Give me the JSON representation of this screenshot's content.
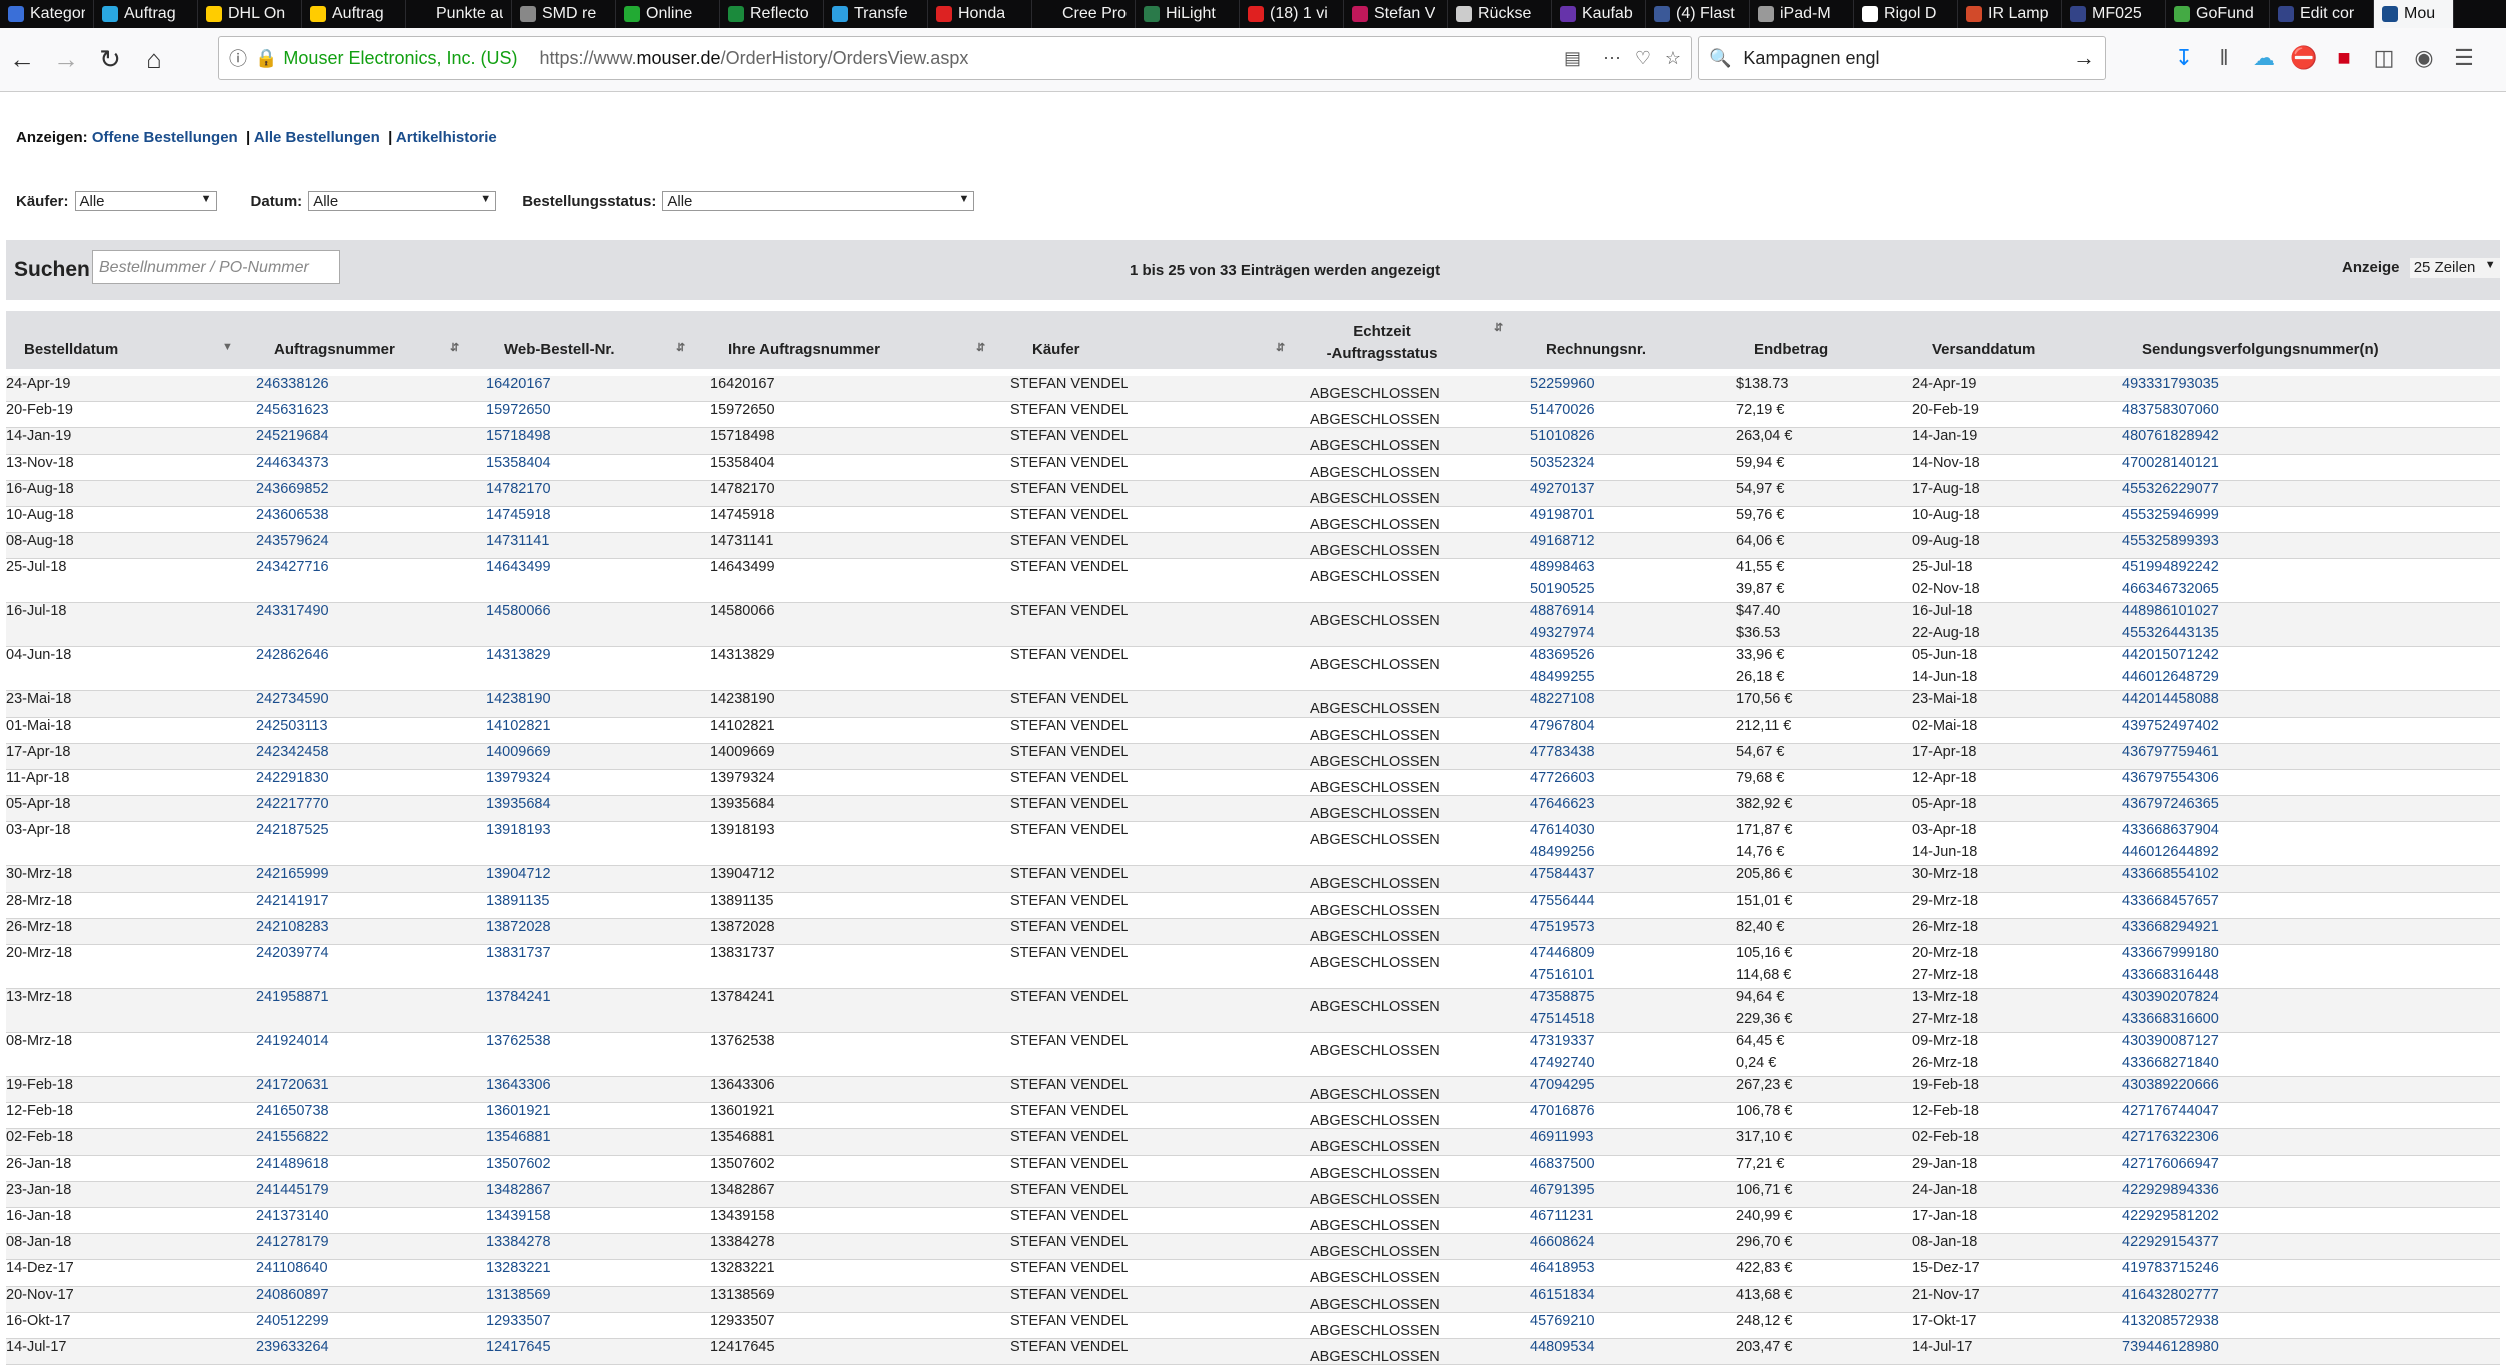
{
  "browser": {
    "tabs": [
      {
        "label": "Kategor",
        "color": "#3a6fd8"
      },
      {
        "label": "Auftrag",
        "color": "#2aa7e0"
      },
      {
        "label": "DHL On",
        "color": "#ffcc00"
      },
      {
        "label": "Auftrag",
        "color": "#ffcc00"
      },
      {
        "label": "Punkte auf e",
        "color": "#0c0c0d"
      },
      {
        "label": "SMD re",
        "color": "#888888"
      },
      {
        "label": "Online",
        "color": "#22aa33"
      },
      {
        "label": "Reflecto",
        "color": "#1b8a3c"
      },
      {
        "label": "Transfe",
        "color": "#2d9fe0"
      },
      {
        "label": "Honda",
        "color": "#dd2222"
      },
      {
        "label": "Cree Produc",
        "color": "#0c0c0d"
      },
      {
        "label": "HiLight",
        "color": "#2a7a4a"
      },
      {
        "label": "(18) 1 vi",
        "color": "#e02020"
      },
      {
        "label": "Stefan V",
        "color": "#c0185a"
      },
      {
        "label": "Rückse",
        "color": "#cccccc"
      },
      {
        "label": "Kaufab",
        "color": "#6633aa"
      },
      {
        "label": "(4) Flast",
        "color": "#3b5998"
      },
      {
        "label": "iPad-M",
        "color": "#999999"
      },
      {
        "label": "Rigol D",
        "color": "#ffffff"
      },
      {
        "label": "IR Lamp",
        "color": "#d24a2a"
      },
      {
        "label": "MF025",
        "color": "#334488"
      },
      {
        "label": "GoFund",
        "color": "#44aa44"
      },
      {
        "label": "Edit cor",
        "color": "#334488"
      },
      {
        "label": "Mou",
        "color": "#1a4d8c"
      }
    ],
    "site_identity": "Mouser Electronics, Inc. (US)",
    "url_prefix": "https://www.",
    "url_domain": "mouser.de",
    "url_path": "/OrderHistory/OrdersView.aspx",
    "search_text": "Kampagnen engl"
  },
  "view": {
    "label": "Anzeigen:",
    "open_orders": "Offene Bestellungen",
    "all_orders": "Alle Bestellungen",
    "item_history": "Artikelhistorie",
    "sep": "|"
  },
  "filters": {
    "buyer_label": "Käufer:",
    "buyer_value": "Alle",
    "date_label": "Datum:",
    "date_value": "Alle",
    "status_label": "Bestellungsstatus:",
    "status_value": "Alle"
  },
  "search": {
    "label": "Suchen",
    "placeholder": "Bestellnummer / PO-Nummer",
    "count_text": "1 bis 25 von 33 Einträgen werden angezeigt",
    "show_label": "Anzeige",
    "show_value": "25 Zeilen"
  },
  "table": {
    "headers": {
      "date": "Bestelldatum",
      "order": "Auftragsnummer",
      "web": "Web-Bestell-Nr.",
      "your": "Ihre Auftragsnummer",
      "buyer": "Käufer",
      "status1": "Echtzeit",
      "status2": "-Auftragsstatus",
      "invoice": "Rechnungsnr.",
      "total": "Endbetrag",
      "ship": "Versanddatum",
      "tracking": "Sendungsverfolgungsnummer(n)"
    },
    "rows": [
      {
        "date": "24-Apr-19",
        "order": "246338126",
        "web": "16420167",
        "your": "16420167",
        "buyer": "STEFAN VENDEL",
        "status": "ABGESCHLOSSEN",
        "invoice": [
          "52259960"
        ],
        "total": [
          "$138.73"
        ],
        "ship": [
          "24-Apr-19"
        ],
        "tracking": [
          "493331793035"
        ]
      },
      {
        "date": "20-Feb-19",
        "order": "245631623",
        "web": "15972650",
        "your": "15972650",
        "buyer": "STEFAN VENDEL",
        "status": "ABGESCHLOSSEN",
        "invoice": [
          "51470026"
        ],
        "total": [
          "72,19 €"
        ],
        "ship": [
          "20-Feb-19"
        ],
        "tracking": [
          "483758307060"
        ]
      },
      {
        "date": "14-Jan-19",
        "order": "245219684",
        "web": "15718498",
        "your": "15718498",
        "buyer": "STEFAN VENDEL",
        "status": "ABGESCHLOSSEN",
        "invoice": [
          "51010826"
        ],
        "total": [
          "263,04 €"
        ],
        "ship": [
          "14-Jan-19"
        ],
        "tracking": [
          "480761828942"
        ]
      },
      {
        "date": "13-Nov-18",
        "order": "244634373",
        "web": "15358404",
        "your": "15358404",
        "buyer": "STEFAN VENDEL",
        "status": "ABGESCHLOSSEN",
        "invoice": [
          "50352324"
        ],
        "total": [
          "59,94 €"
        ],
        "ship": [
          "14-Nov-18"
        ],
        "tracking": [
          "470028140121"
        ]
      },
      {
        "date": "16-Aug-18",
        "order": "243669852",
        "web": "14782170",
        "your": "14782170",
        "buyer": "STEFAN VENDEL",
        "status": "ABGESCHLOSSEN",
        "invoice": [
          "49270137"
        ],
        "total": [
          "54,97 €"
        ],
        "ship": [
          "17-Aug-18"
        ],
        "tracking": [
          "455326229077"
        ]
      },
      {
        "date": "10-Aug-18",
        "order": "243606538",
        "web": "14745918",
        "your": "14745918",
        "buyer": "STEFAN VENDEL",
        "status": "ABGESCHLOSSEN",
        "invoice": [
          "49198701"
        ],
        "total": [
          "59,76 €"
        ],
        "ship": [
          "10-Aug-18"
        ],
        "tracking": [
          "455325946999"
        ]
      },
      {
        "date": "08-Aug-18",
        "order": "243579624",
        "web": "14731141",
        "your": "14731141",
        "buyer": "STEFAN VENDEL",
        "status": "ABGESCHLOSSEN",
        "invoice": [
          "49168712"
        ],
        "total": [
          "64,06 €"
        ],
        "ship": [
          "09-Aug-18"
        ],
        "tracking": [
          "455325899393"
        ]
      },
      {
        "date": "25-Jul-18",
        "order": "243427716",
        "web": "14643499",
        "your": "14643499",
        "buyer": "STEFAN VENDEL",
        "status": "ABGESCHLOSSEN",
        "invoice": [
          "48998463",
          "50190525"
        ],
        "total": [
          "41,55 €",
          "39,87 €"
        ],
        "ship": [
          "25-Jul-18",
          "02-Nov-18"
        ],
        "tracking": [
          "451994892242",
          "466346732065"
        ]
      },
      {
        "date": "16-Jul-18",
        "order": "243317490",
        "web": "14580066",
        "your": "14580066",
        "buyer": "STEFAN VENDEL",
        "status": "ABGESCHLOSSEN",
        "invoice": [
          "48876914",
          "49327974"
        ],
        "total": [
          "$47.40",
          "$36.53"
        ],
        "ship": [
          "16-Jul-18",
          "22-Aug-18"
        ],
        "tracking": [
          "448986101027",
          "455326443135"
        ]
      },
      {
        "date": "04-Jun-18",
        "order": "242862646",
        "web": "14313829",
        "your": "14313829",
        "buyer": "STEFAN VENDEL",
        "status": "ABGESCHLOSSEN",
        "invoice": [
          "48369526",
          "48499255"
        ],
        "total": [
          "33,96 €",
          "26,18 €"
        ],
        "ship": [
          "05-Jun-18",
          "14-Jun-18"
        ],
        "tracking": [
          "442015071242",
          "446012648729"
        ]
      },
      {
        "date": "23-Mai-18",
        "order": "242734590",
        "web": "14238190",
        "your": "14238190",
        "buyer": "STEFAN VENDEL",
        "status": "ABGESCHLOSSEN",
        "invoice": [
          "48227108"
        ],
        "total": [
          "170,56 €"
        ],
        "ship": [
          "23-Mai-18"
        ],
        "tracking": [
          "442014458088"
        ]
      },
      {
        "date": "01-Mai-18",
        "order": "242503113",
        "web": "14102821",
        "your": "14102821",
        "buyer": "STEFAN VENDEL",
        "status": "ABGESCHLOSSEN",
        "invoice": [
          "47967804"
        ],
        "total": [
          "212,11 €"
        ],
        "ship": [
          "02-Mai-18"
        ],
        "tracking": [
          "439752497402"
        ]
      },
      {
        "date": "17-Apr-18",
        "order": "242342458",
        "web": "14009669",
        "your": "14009669",
        "buyer": "STEFAN VENDEL",
        "status": "ABGESCHLOSSEN",
        "invoice": [
          "47783438"
        ],
        "total": [
          "54,67 €"
        ],
        "ship": [
          "17-Apr-18"
        ],
        "tracking": [
          "436797759461"
        ]
      },
      {
        "date": "11-Apr-18",
        "order": "242291830",
        "web": "13979324",
        "your": "13979324",
        "buyer": "STEFAN VENDEL",
        "status": "ABGESCHLOSSEN",
        "invoice": [
          "47726603"
        ],
        "total": [
          "79,68 €"
        ],
        "ship": [
          "12-Apr-18"
        ],
        "tracking": [
          "436797554306"
        ]
      },
      {
        "date": "05-Apr-18",
        "order": "242217770",
        "web": "13935684",
        "your": "13935684",
        "buyer": "STEFAN VENDEL",
        "status": "ABGESCHLOSSEN",
        "invoice": [
          "47646623"
        ],
        "total": [
          "382,92 €"
        ],
        "ship": [
          "05-Apr-18"
        ],
        "tracking": [
          "436797246365"
        ]
      },
      {
        "date": "03-Apr-18",
        "order": "242187525",
        "web": "13918193",
        "your": "13918193",
        "buyer": "STEFAN VENDEL",
        "status": "ABGESCHLOSSEN",
        "invoice": [
          "47614030",
          "48499256"
        ],
        "total": [
          "171,87 €",
          "14,76 €"
        ],
        "ship": [
          "03-Apr-18",
          "14-Jun-18"
        ],
        "tracking": [
          "433668637904",
          "446012644892"
        ]
      },
      {
        "date": "30-Mrz-18",
        "order": "242165999",
        "web": "13904712",
        "your": "13904712",
        "buyer": "STEFAN VENDEL",
        "status": "ABGESCHLOSSEN",
        "invoice": [
          "47584437"
        ],
        "total": [
          "205,86 €"
        ],
        "ship": [
          "30-Mrz-18"
        ],
        "tracking": [
          "433668554102"
        ]
      },
      {
        "date": "28-Mrz-18",
        "order": "242141917",
        "web": "13891135",
        "your": "13891135",
        "buyer": "STEFAN VENDEL",
        "status": "ABGESCHLOSSEN",
        "invoice": [
          "47556444"
        ],
        "total": [
          "151,01 €"
        ],
        "ship": [
          "29-Mrz-18"
        ],
        "tracking": [
          "433668457657"
        ]
      },
      {
        "date": "26-Mrz-18",
        "order": "242108283",
        "web": "13872028",
        "your": "13872028",
        "buyer": "STEFAN VENDEL",
        "status": "ABGESCHLOSSEN",
        "invoice": [
          "47519573"
        ],
        "total": [
          "82,40 €"
        ],
        "ship": [
          "26-Mrz-18"
        ],
        "tracking": [
          "433668294921"
        ]
      },
      {
        "date": "20-Mrz-18",
        "order": "242039774",
        "web": "13831737",
        "your": "13831737",
        "buyer": "STEFAN VENDEL",
        "status": "ABGESCHLOSSEN",
        "invoice": [
          "47446809",
          "47516101"
        ],
        "total": [
          "105,16 €",
          "114,68 €"
        ],
        "ship": [
          "20-Mrz-18",
          "27-Mrz-18"
        ],
        "tracking": [
          "433667999180",
          "433668316448"
        ]
      },
      {
        "date": "13-Mrz-18",
        "order": "241958871",
        "web": "13784241",
        "your": "13784241",
        "buyer": "STEFAN VENDEL",
        "status": "ABGESCHLOSSEN",
        "invoice": [
          "47358875",
          "47514518"
        ],
        "total": [
          "94,64 €",
          "229,36 €"
        ],
        "ship": [
          "13-Mrz-18",
          "27-Mrz-18"
        ],
        "tracking": [
          "430390207824",
          "433668316600"
        ]
      },
      {
        "date": "08-Mrz-18",
        "order": "241924014",
        "web": "13762538",
        "your": "13762538",
        "buyer": "STEFAN VENDEL",
        "status": "ABGESCHLOSSEN",
        "invoice": [
          "47319337",
          "47492740"
        ],
        "total": [
          "64,45 €",
          "0,24 €"
        ],
        "ship": [
          "09-Mrz-18",
          "26-Mrz-18"
        ],
        "tracking": [
          "430390087127",
          "433668271840"
        ]
      },
      {
        "date": "19-Feb-18",
        "order": "241720631",
        "web": "13643306",
        "your": "13643306",
        "buyer": "STEFAN VENDEL",
        "status": "ABGESCHLOSSEN",
        "invoice": [
          "47094295"
        ],
        "total": [
          "267,23 €"
        ],
        "ship": [
          "19-Feb-18"
        ],
        "tracking": [
          "430389220666"
        ]
      },
      {
        "date": "12-Feb-18",
        "order": "241650738",
        "web": "13601921",
        "your": "13601921",
        "buyer": "STEFAN VENDEL",
        "status": "ABGESCHLOSSEN",
        "invoice": [
          "47016876"
        ],
        "total": [
          "106,78 €"
        ],
        "ship": [
          "12-Feb-18"
        ],
        "tracking": [
          "427176744047"
        ]
      },
      {
        "date": "02-Feb-18",
        "order": "241556822",
        "web": "13546881",
        "your": "13546881",
        "buyer": "STEFAN VENDEL",
        "status": "ABGESCHLOSSEN",
        "invoice": [
          "46911993"
        ],
        "total": [
          "317,10 €"
        ],
        "ship": [
          "02-Feb-18"
        ],
        "tracking": [
          "427176322306"
        ]
      },
      {
        "date": "26-Jan-18",
        "order": "241489618",
        "web": "13507602",
        "your": "13507602",
        "buyer": "STEFAN VENDEL",
        "status": "ABGESCHLOSSEN",
        "invoice": [
          "46837500"
        ],
        "total": [
          "77,21 €"
        ],
        "ship": [
          "29-Jan-18"
        ],
        "tracking": [
          "427176066947"
        ]
      },
      {
        "date": "23-Jan-18",
        "order": "241445179",
        "web": "13482867",
        "your": "13482867",
        "buyer": "STEFAN VENDEL",
        "status": "ABGESCHLOSSEN",
        "invoice": [
          "46791395"
        ],
        "total": [
          "106,71 €"
        ],
        "ship": [
          "24-Jan-18"
        ],
        "tracking": [
          "422929894336"
        ]
      },
      {
        "date": "16-Jan-18",
        "order": "241373140",
        "web": "13439158",
        "your": "13439158",
        "buyer": "STEFAN VENDEL",
        "status": "ABGESCHLOSSEN",
        "invoice": [
          "46711231"
        ],
        "total": [
          "240,99 €"
        ],
        "ship": [
          "17-Jan-18"
        ],
        "tracking": [
          "422929581202"
        ]
      },
      {
        "date": "08-Jan-18",
        "order": "241278179",
        "web": "13384278",
        "your": "13384278",
        "buyer": "STEFAN VENDEL",
        "status": "ABGESCHLOSSEN",
        "invoice": [
          "46608624"
        ],
        "total": [
          "296,70 €"
        ],
        "ship": [
          "08-Jan-18"
        ],
        "tracking": [
          "422929154377"
        ]
      },
      {
        "date": "14-Dez-17",
        "order": "241108640",
        "web": "13283221",
        "your": "13283221",
        "buyer": "STEFAN VENDEL",
        "status": "ABGESCHLOSSEN",
        "invoice": [
          "46418953"
        ],
        "total": [
          "422,83 €"
        ],
        "ship": [
          "15-Dez-17"
        ],
        "tracking": [
          "419783715246"
        ]
      },
      {
        "date": "20-Nov-17",
        "order": "240860897",
        "web": "13138569",
        "your": "13138569",
        "buyer": "STEFAN VENDEL",
        "status": "ABGESCHLOSSEN",
        "invoice": [
          "46151834"
        ],
        "total": [
          "413,68 €"
        ],
        "ship": [
          "21-Nov-17"
        ],
        "tracking": [
          "416432802777"
        ]
      },
      {
        "date": "16-Okt-17",
        "order": "240512299",
        "web": "12933507",
        "your": "12933507",
        "buyer": "STEFAN VENDEL",
        "status": "ABGESCHLOSSEN",
        "invoice": [
          "45769210"
        ],
        "total": [
          "248,12 €"
        ],
        "ship": [
          "17-Okt-17"
        ],
        "tracking": [
          "413208572938"
        ]
      },
      {
        "date": "14-Jul-17",
        "order": "239633264",
        "web": "12417645",
        "your": "12417645",
        "buyer": "STEFAN VENDEL",
        "status": "ABGESCHLOSSEN",
        "invoice": [
          "44809534"
        ],
        "total": [
          "203,47 €"
        ],
        "ship": [
          "14-Jul-17"
        ],
        "tracking": [
          "739446128980"
        ]
      }
    ]
  }
}
